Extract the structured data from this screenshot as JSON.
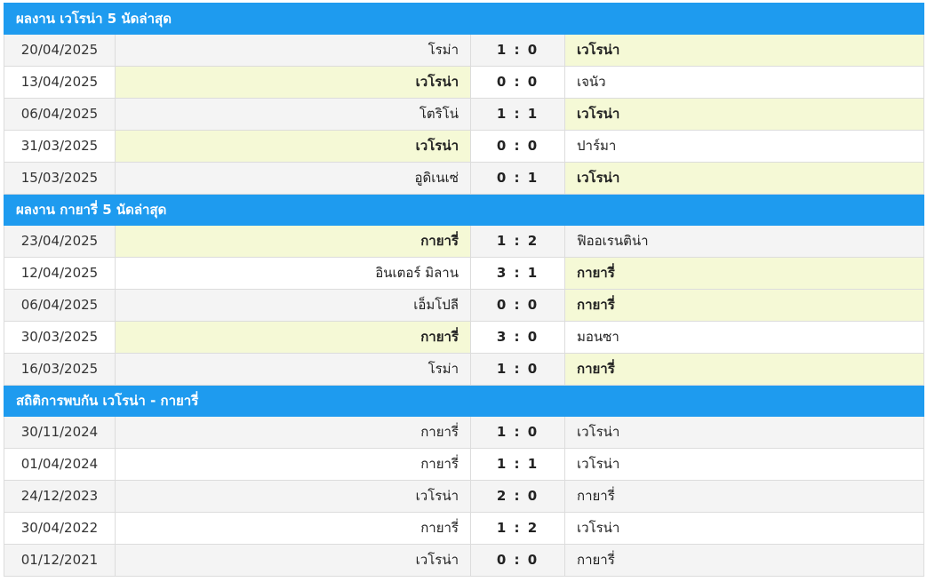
{
  "sections": [
    {
      "title": "ผลงาน เวโรน่า 5 นัดล่าสุด",
      "matches": [
        {
          "date": "20/04/2025",
          "home": "โรม่า",
          "score": "1 : 0",
          "away": "เวโรน่า",
          "highlight": "away"
        },
        {
          "date": "13/04/2025",
          "home": "เวโรน่า",
          "score": "0 : 0",
          "away": "เจนัว",
          "highlight": "home"
        },
        {
          "date": "06/04/2025",
          "home": "โตริโน่",
          "score": "1 : 1",
          "away": "เวโรน่า",
          "highlight": "away"
        },
        {
          "date": "31/03/2025",
          "home": "เวโรน่า",
          "score": "0 : 0",
          "away": "ปาร์มา",
          "highlight": "home"
        },
        {
          "date": "15/03/2025",
          "home": "อูดิเนเซ่",
          "score": "0 : 1",
          "away": "เวโรน่า",
          "highlight": "away"
        }
      ]
    },
    {
      "title": "ผลงาน กายารี่ 5 นัดล่าสุด",
      "matches": [
        {
          "date": "23/04/2025",
          "home": "กายารี่",
          "score": "1 : 2",
          "away": "ฟิออเรนติน่า",
          "highlight": "home"
        },
        {
          "date": "12/04/2025",
          "home": "อินเตอร์ มิลาน",
          "score": "3 : 1",
          "away": "กายารี่",
          "highlight": "away"
        },
        {
          "date": "06/04/2025",
          "home": "เอ็มโปลี",
          "score": "0 : 0",
          "away": "กายารี่",
          "highlight": "away"
        },
        {
          "date": "30/03/2025",
          "home": "กายารี่",
          "score": "3 : 0",
          "away": "มอนซา",
          "highlight": "home"
        },
        {
          "date": "16/03/2025",
          "home": "โรม่า",
          "score": "1 : 0",
          "away": "กายารี่",
          "highlight": "away"
        }
      ]
    },
    {
      "title": "สถิติการพบกัน เวโรน่า - กายารี่",
      "matches": [
        {
          "date": "30/11/2024",
          "home": "กายารี่",
          "score": "1 : 0",
          "away": "เวโรน่า",
          "highlight": "none"
        },
        {
          "date": "01/04/2024",
          "home": "กายารี่",
          "score": "1 : 1",
          "away": "เวโรน่า",
          "highlight": "none"
        },
        {
          "date": "24/12/2023",
          "home": "เวโรน่า",
          "score": "2 : 0",
          "away": "กายารี่",
          "highlight": "none"
        },
        {
          "date": "30/04/2022",
          "home": "กายารี่",
          "score": "1 : 2",
          "away": "เวโรน่า",
          "highlight": "none"
        },
        {
          "date": "01/12/2021",
          "home": "เวโรน่า",
          "score": "0 : 0",
          "away": "กายารี่",
          "highlight": "none"
        }
      ]
    }
  ],
  "colors": {
    "header_bg": "#1e9bef",
    "header_text": "#ffffff",
    "row_alt_bg": "#f4f4f4",
    "highlight_bg": "#f5f9d6"
  }
}
